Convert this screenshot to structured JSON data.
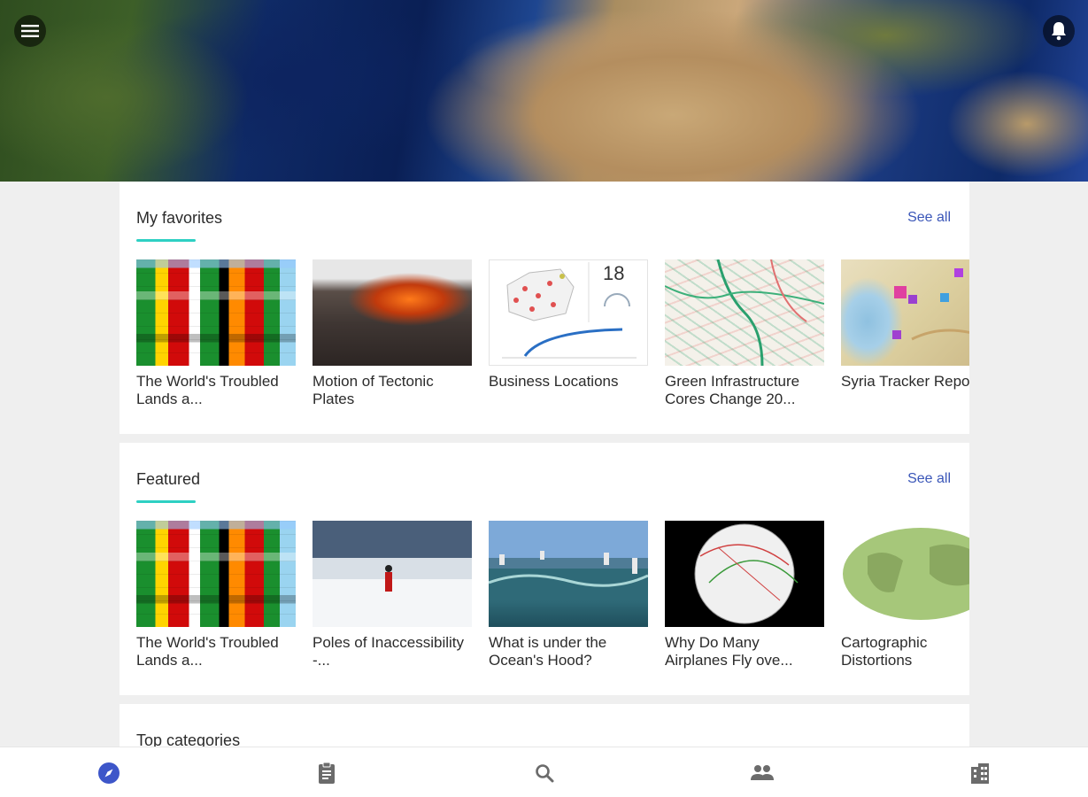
{
  "banner": {
    "menu_icon": "hamburger-menu-icon",
    "notification_icon": "bell-icon"
  },
  "favorites": {
    "title": "My favorites",
    "see_all": "See all",
    "items": [
      {
        "title": "The World's Troubled Lands a...",
        "thumb": "flags-map"
      },
      {
        "title": "Motion of Tectonic Plates",
        "thumb": "lava"
      },
      {
        "title": "Business Locations",
        "thumb": "dashboard",
        "badge_value": "18"
      },
      {
        "title": "Green Infrastructure Cores Change 20...",
        "thumb": "green-map"
      },
      {
        "title": "Syria Tracker Reports",
        "thumb": "syria-map"
      }
    ]
  },
  "featured": {
    "title": "Featured",
    "see_all": "See all",
    "items": [
      {
        "title": "The World's Troubled Lands a...",
        "thumb": "flags-map"
      },
      {
        "title": "Poles of Inaccessibility -...",
        "thumb": "arctic"
      },
      {
        "title": "What is under the Ocean's Hood?",
        "thumb": "ocean"
      },
      {
        "title": "Why Do Many Airplanes Fly ove...",
        "thumb": "globe"
      },
      {
        "title": "Cartographic Distortions",
        "thumb": "world-projection"
      }
    ]
  },
  "top_categories": {
    "title": "Top categories"
  },
  "bottom_nav": {
    "items": [
      {
        "name": "explore",
        "icon": "compass-icon",
        "active": true
      },
      {
        "name": "content",
        "icon": "clipboard-icon",
        "active": false
      },
      {
        "name": "search",
        "icon": "search-icon",
        "active": false
      },
      {
        "name": "groups",
        "icon": "people-icon",
        "active": false
      },
      {
        "name": "organization",
        "icon": "building-icon",
        "active": false
      }
    ]
  },
  "colors": {
    "accent": "#2ed0c3",
    "link": "#3a56b8",
    "active_nav": "#3d56c9",
    "inactive_nav": "#6b6b6b"
  }
}
